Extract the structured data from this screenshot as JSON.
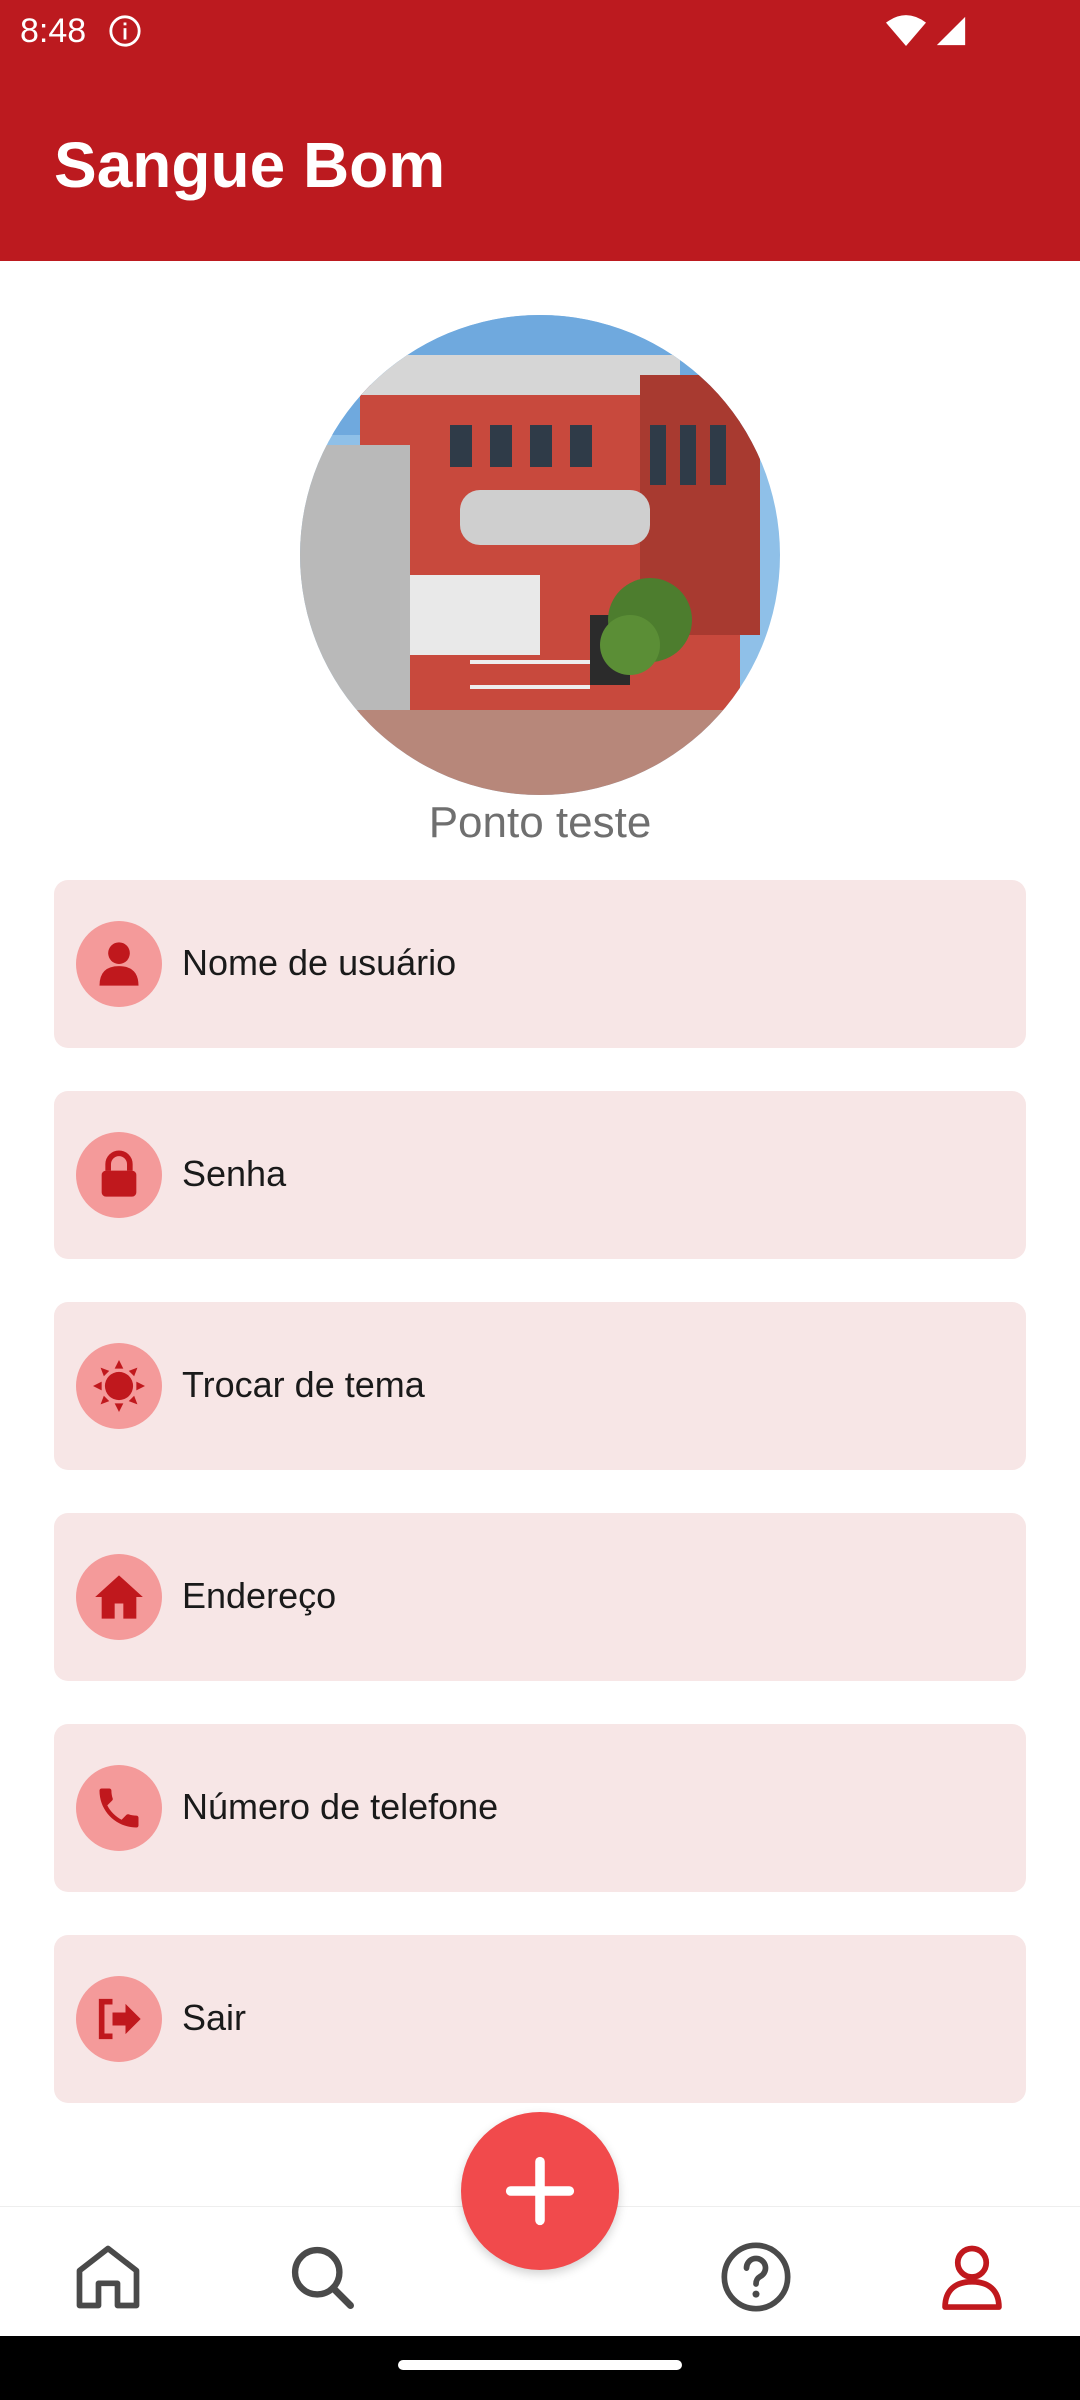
{
  "status_bar": {
    "time": "8:48"
  },
  "app_bar": {
    "title": "Sangue Bom"
  },
  "profile": {
    "name": "Ponto teste"
  },
  "menu": [
    {
      "label": "Nome de usuário",
      "icon": "user-icon"
    },
    {
      "label": "Senha",
      "icon": "lock-icon"
    },
    {
      "label": "Trocar de tema",
      "icon": "sun-icon"
    },
    {
      "label": "Endereço",
      "icon": "home-icon"
    },
    {
      "label": "Número de telefone",
      "icon": "phone-icon"
    },
    {
      "label": "Sair",
      "icon": "logout-icon"
    }
  ],
  "bottom_nav": {
    "items": [
      "home-icon",
      "search-icon",
      "help-icon",
      "profile-icon"
    ],
    "active": "profile-icon"
  },
  "colors": {
    "primary": "#bc1a1f",
    "fab": "#f14a4c",
    "item_bg": "#f7e6e6",
    "icon_bg": "#f49a9a",
    "icon_fg": "#c0181d"
  }
}
